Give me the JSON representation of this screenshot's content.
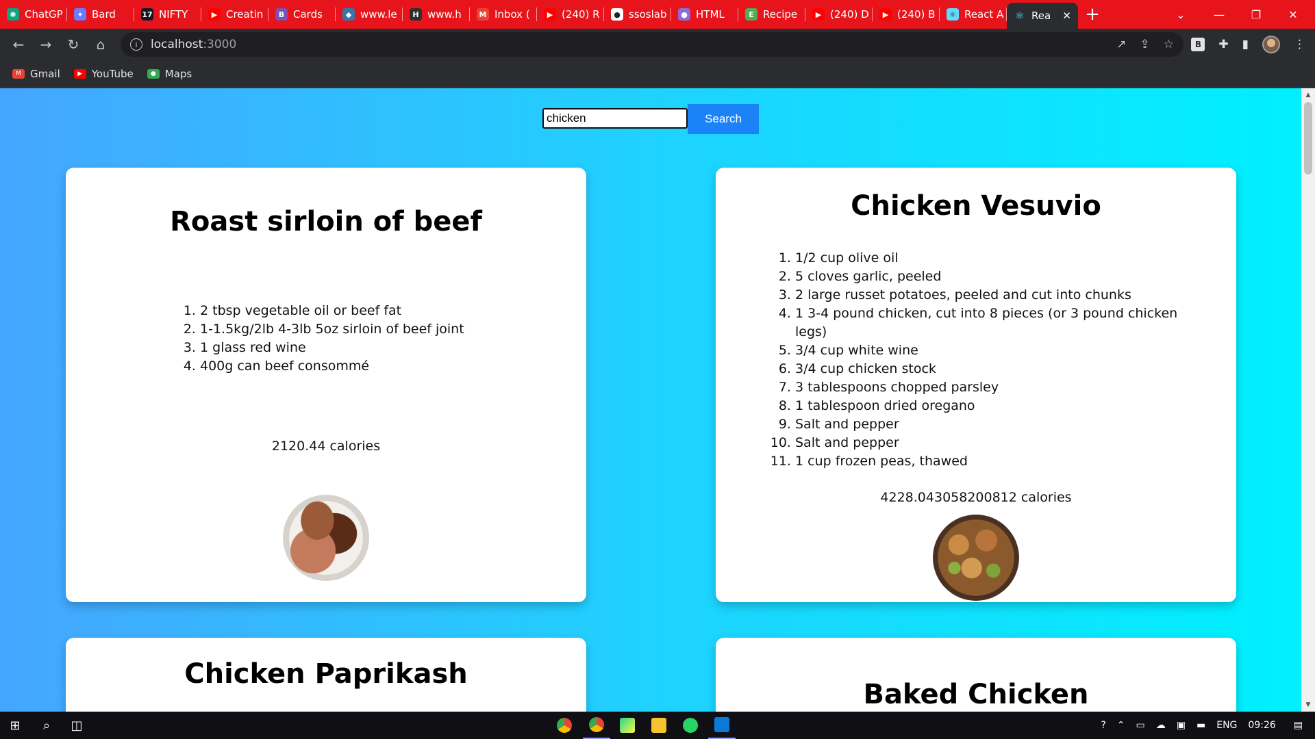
{
  "browser": {
    "tabs": [
      {
        "label": "ChatGP",
        "icon": "chatgpt-icon",
        "color": "#10a37f",
        "glyph": "✺"
      },
      {
        "label": "Bard",
        "icon": "bard-icon",
        "color": "#6b7bff",
        "glyph": "✦"
      },
      {
        "label": "NIFTY",
        "icon": "tradingview-icon",
        "color": "#131722",
        "glyph": "17"
      },
      {
        "label": "Creatin",
        "icon": "youtube-icon",
        "color": "#ff0000",
        "glyph": "▶"
      },
      {
        "label": "Cards",
        "icon": "bootstrap-icon",
        "color": "#7952b3",
        "glyph": "B"
      },
      {
        "label": "www.le",
        "icon": "python-icon",
        "color": "#3776ab",
        "glyph": "◆"
      },
      {
        "label": "www.h",
        "icon": "hackerrank-icon",
        "color": "#2e2e2e",
        "glyph": "H"
      },
      {
        "label": "Inbox (",
        "icon": "gmail-icon",
        "color": "#ea4335",
        "glyph": "M"
      },
      {
        "label": "(240) R",
        "icon": "youtube-icon",
        "color": "#ff0000",
        "glyph": "▶"
      },
      {
        "label": "ssoslab",
        "icon": "globe-icon",
        "color": "#ffffff",
        "glyph": "●"
      },
      {
        "label": "HTML",
        "icon": "profile-icon",
        "color": "#8e6bd6",
        "glyph": "●"
      },
      {
        "label": "Recipe",
        "icon": "edamam-icon",
        "color": "#4caf50",
        "glyph": "E"
      },
      {
        "label": "(240) D",
        "icon": "youtube-icon",
        "color": "#ff0000",
        "glyph": "▶"
      },
      {
        "label": "(240) B",
        "icon": "youtube-icon",
        "color": "#ff0000",
        "glyph": "▶"
      },
      {
        "label": "React A",
        "icon": "react-icon",
        "color": "#61dafb",
        "glyph": "⚛"
      }
    ],
    "active_tab": {
      "label": "Rea",
      "icon": "react-icon",
      "glyph": "⚛",
      "close": "✕"
    },
    "new_tab": "+",
    "window": {
      "dropdown": "⌄",
      "minimize": "—",
      "restore": "❐",
      "close": "✕"
    },
    "nav": {
      "back": "←",
      "forward": "→",
      "reload": "↻",
      "home": "⌂"
    },
    "address": {
      "host": "localhost",
      "port": ":3000",
      "info": "i"
    },
    "omni_actions": [
      "↗",
      "⇪",
      "☆"
    ],
    "extensions": {
      "ext_b": "B",
      "puzzle": "✚",
      "sidepanel": "▮",
      "menu": "⋮"
    },
    "bookmarks": [
      {
        "label": "Gmail",
        "icon": "gmail-icon",
        "color": "#ea4335",
        "glyph": "M"
      },
      {
        "label": "YouTube",
        "icon": "youtube-icon",
        "color": "#ff0000",
        "glyph": "▶"
      },
      {
        "label": "Maps",
        "icon": "maps-icon",
        "color": "#34a853",
        "glyph": "●"
      }
    ]
  },
  "page": {
    "search": {
      "value": "chicken",
      "button_label": "Search"
    },
    "recipes": [
      {
        "title": "Roast sirloin of beef",
        "ingredients": [
          "2 tbsp vegetable oil or beef fat",
          "1-1.5kg/2lb 4-3lb 5oz sirloin of beef joint",
          "1 glass red wine",
          "400g can beef consommé"
        ],
        "calories": "2120.44 calories",
        "image": "roast-beef-image"
      },
      {
        "title": "Chicken Vesuvio",
        "ingredients": [
          "1/2 cup olive oil",
          "5 cloves garlic, peeled",
          "2 large russet potatoes, peeled and cut into chunks",
          "1 3-4 pound chicken, cut into 8 pieces (or 3 pound chicken legs)",
          "3/4 cup white wine",
          "3/4 cup chicken stock",
          "3 tablespoons chopped parsley",
          "1 tablespoon dried oregano",
          "Salt and pepper",
          "Salt and pepper",
          "1 cup frozen peas, thawed"
        ],
        "calories": "4228.043058200812 calories",
        "image": "chicken-vesuvio-image"
      },
      {
        "title": "Chicken Paprikash"
      },
      {
        "title": "Baked Chicken"
      }
    ],
    "colors": {
      "gradient_start": "#45a6ff",
      "gradient_end": "#00f0ff",
      "button": "#1b82f8"
    }
  },
  "taskbar": {
    "tray": {
      "language": "ENG",
      "time": "09:26"
    }
  }
}
